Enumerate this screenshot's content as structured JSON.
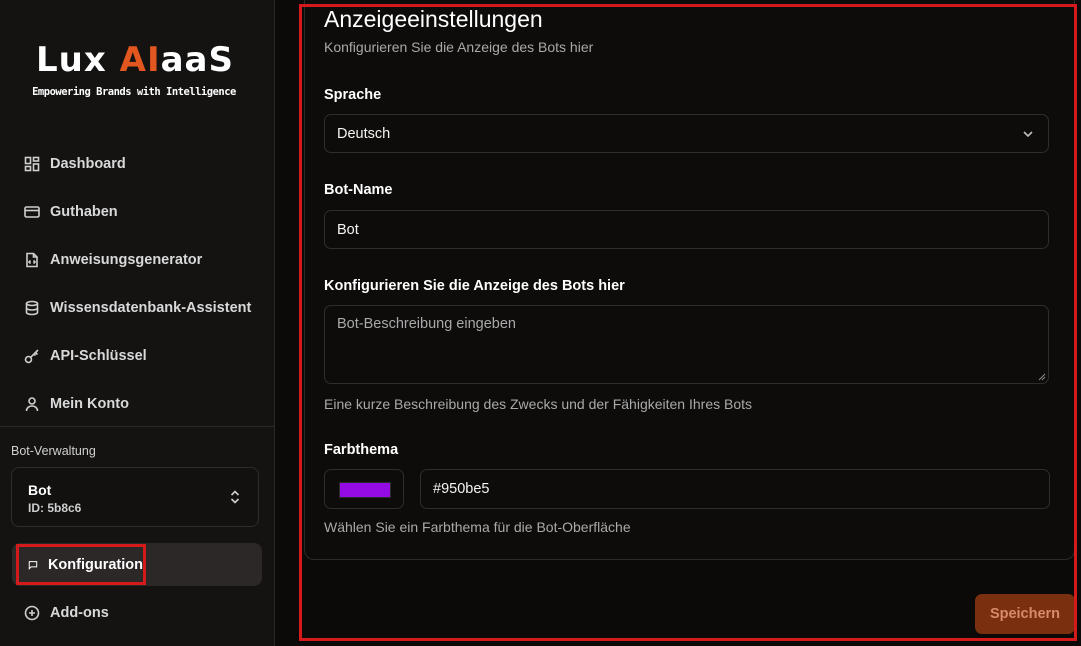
{
  "brand": {
    "logo_prefix": "Lux ",
    "logo_accent": "AI",
    "logo_suffix": "aaS",
    "tagline": "Empowering Brands with Intelligence",
    "accent_color": "#e2571f"
  },
  "sidebar": {
    "items": [
      {
        "label": "Dashboard",
        "icon": "dashboard-icon"
      },
      {
        "label": "Guthaben",
        "icon": "credit-card-icon"
      },
      {
        "label": "Anweisungsgenerator",
        "icon": "code-file-icon"
      },
      {
        "label": "Wissensdatenbank-Assistent",
        "icon": "database-icon"
      },
      {
        "label": "API-Schlüssel",
        "icon": "key-icon"
      },
      {
        "label": "Mein Konto",
        "icon": "user-icon"
      }
    ],
    "section_label": "Bot-Verwaltung",
    "bot": {
      "name": "Bot",
      "id": "ID: 5b8c6"
    },
    "bot_items": [
      {
        "label": "Konfiguration",
        "icon": "message-square-icon",
        "active": true
      },
      {
        "label": "Add-ons",
        "icon": "plus-circle-icon"
      }
    ]
  },
  "main": {
    "title": "Anzeigeeinstellungen",
    "subtitle": "Konfigurieren Sie die Anzeige des Bots hier",
    "language": {
      "label": "Sprache",
      "value": "Deutsch"
    },
    "bot_name": {
      "label": "Bot-Name",
      "value": "Bot"
    },
    "description": {
      "label": "Konfigurieren Sie die Anzeige des Bots hier",
      "placeholder": "Bot-Beschreibung eingeben",
      "hint": "Eine kurze Beschreibung des Zwecks und der Fähigkeiten Ihres Bots"
    },
    "theme": {
      "label": "Farbthema",
      "value": "#950be5",
      "hint": "Wählen Sie ein Farbthema für die Bot-Oberfläche"
    },
    "save_label": "Speichern"
  }
}
